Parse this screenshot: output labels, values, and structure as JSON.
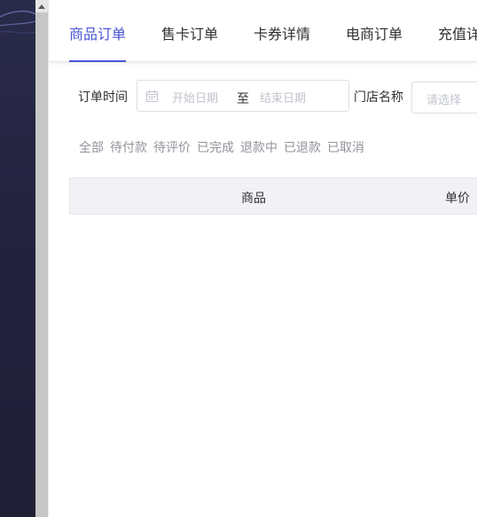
{
  "tabs": [
    {
      "label": "商品订单",
      "active": true
    },
    {
      "label": "售卡订单",
      "active": false
    },
    {
      "label": "卡券详情",
      "active": false
    },
    {
      "label": "电商订单",
      "active": false
    },
    {
      "label": "充值详"
    }
  ],
  "filters": {
    "order_time_label": "订单时间",
    "start_placeholder": "开始日期",
    "range_separator": "至",
    "end_placeholder": "结束日期",
    "store_label": "门店名称",
    "store_placeholder": "请选择"
  },
  "status_tabs": [
    "全部",
    "待付款",
    "待评价",
    "已完成",
    "退款中",
    "已退款",
    "已取消"
  ],
  "table": {
    "headers": [
      "商品",
      "单价"
    ]
  },
  "colors": {
    "accent": "#4a55d6",
    "sidebar": "#232340",
    "text": "#303133",
    "muted": "#909399",
    "placeholder": "#c0c4cc"
  }
}
